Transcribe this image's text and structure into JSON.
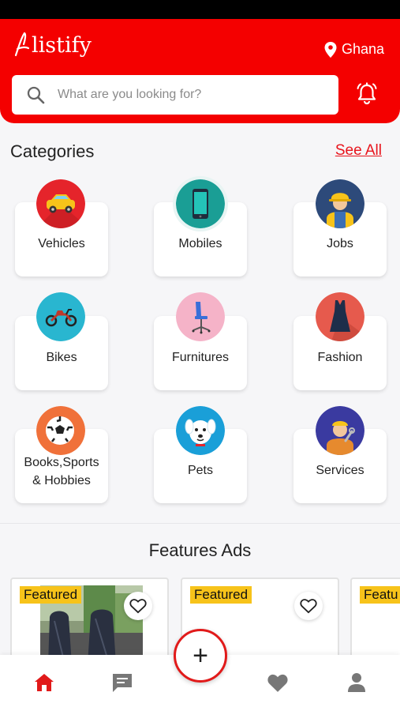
{
  "app": {
    "name": "listify"
  },
  "header": {
    "location": "Ghana",
    "search_placeholder": "What are you looking for?",
    "brand_color": "#f40000"
  },
  "categories": {
    "title": "Categories",
    "see_all": "See All",
    "items": [
      {
        "label": "Vehicles",
        "icon": "car-icon",
        "color": "#e5242b"
      },
      {
        "label": "Mobiles",
        "icon": "mobile-phone-icon",
        "color": "#1a9e95"
      },
      {
        "label": "Jobs",
        "icon": "worker-icon",
        "color": "#2d4a7a"
      },
      {
        "label": "Bikes",
        "icon": "motorbike-icon",
        "color": "#29b6d0"
      },
      {
        "label": "Furnitures",
        "icon": "office-chair-icon",
        "color": "#f5b3c8"
      },
      {
        "label": "Fashion",
        "icon": "dress-icon",
        "color": "#e65a4d"
      },
      {
        "label": "Books,Sports & Hobbies",
        "icon": "football-icon",
        "color": "#f0713a"
      },
      {
        "label": "Pets",
        "icon": "dog-icon",
        "color": "#1a9fd8"
      },
      {
        "label": "Services",
        "icon": "repairman-icon",
        "color": "#3a3aa0"
      }
    ]
  },
  "featured": {
    "title": "Features Ads",
    "badge": "Featured",
    "badge_partial": "Featu",
    "badge_color": "#f7c31a"
  },
  "fab": {
    "label": "+"
  },
  "nav": {
    "active_color": "#e11a1a",
    "inactive_color": "#777777",
    "items": [
      "home-icon",
      "chat-icon",
      "heart-icon",
      "profile-icon"
    ]
  }
}
